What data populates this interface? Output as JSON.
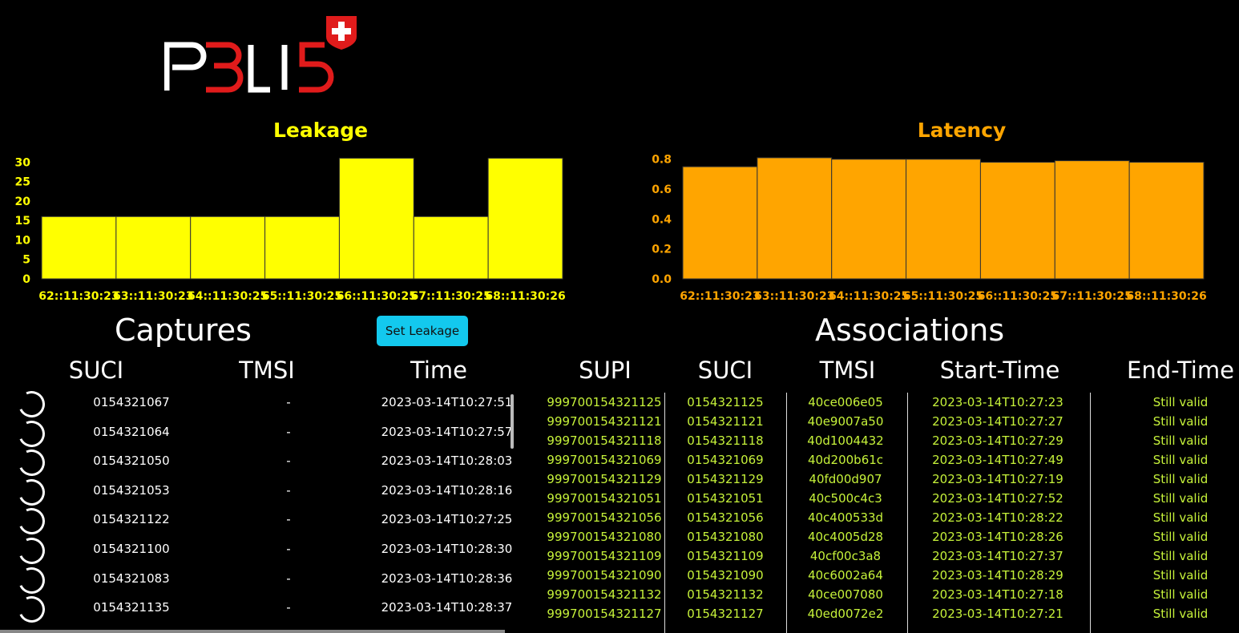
{
  "logo": {
    "text": "P3LI5",
    "flag": "swiss-flag"
  },
  "colors": {
    "leakage": "#ffff00",
    "latency": "#ffa500",
    "button": "#13c9ee",
    "assoc_text": "#c6f23a"
  },
  "chart_data": [
    {
      "type": "bar",
      "title": "Leakage",
      "categories": [
        "62::11:30:23",
        "63::11:30:23",
        "64::11:30:25",
        "65::11:30:25",
        "66::11:30:25",
        "67::11:30:25",
        "68::11:30:26"
      ],
      "values": [
        16,
        16,
        16,
        16,
        31,
        16,
        31
      ],
      "yticks": [
        0,
        5,
        10,
        15,
        20,
        25,
        30
      ],
      "ylim": [
        0,
        31.5
      ],
      "color": "#ffff00"
    },
    {
      "type": "bar",
      "title": "Latency",
      "categories": [
        "62::11:30:23",
        "63::11:30:23",
        "64::11:30:25",
        "65::11:30:25",
        "66::11:30:25",
        "67::11:30:25",
        "68::11:30:26"
      ],
      "values": [
        0.75,
        0.81,
        0.8,
        0.8,
        0.78,
        0.79,
        0.78
      ],
      "yticks": [
        "0.0",
        "0.2",
        "0.4",
        "0.6",
        "0.8"
      ],
      "ylim": [
        0,
        0.82
      ],
      "color": "#ffa500"
    }
  ],
  "captures": {
    "title": "Captures",
    "button_label": "Set Leakage",
    "headers": [
      "SUCI",
      "TMSI",
      "Time"
    ],
    "rows": [
      [
        "0154321067",
        "-",
        "2023-03-14T10:27:51"
      ],
      [
        "0154321064",
        "-",
        "2023-03-14T10:27:57"
      ],
      [
        "0154321050",
        "-",
        "2023-03-14T10:28:03"
      ],
      [
        "0154321053",
        "-",
        "2023-03-14T10:28:16"
      ],
      [
        "0154321122",
        "-",
        "2023-03-14T10:27:25"
      ],
      [
        "0154321100",
        "-",
        "2023-03-14T10:28:30"
      ],
      [
        "0154321083",
        "-",
        "2023-03-14T10:28:36"
      ],
      [
        "0154321135",
        "-",
        "2023-03-14T10:28:37"
      ]
    ]
  },
  "associations": {
    "title": "Associations",
    "headers": [
      "SUPI",
      "SUCI",
      "TMSI",
      "Start-Time",
      "End-Time"
    ],
    "rows": [
      [
        "999700154321125",
        "0154321125",
        "40ce006e05",
        "2023-03-14T10:27:23",
        "Still valid"
      ],
      [
        "999700154321121",
        "0154321121",
        "40e9007a50",
        "2023-03-14T10:27:27",
        "Still valid"
      ],
      [
        "999700154321118",
        "0154321118",
        "40d1004432",
        "2023-03-14T10:27:29",
        "Still valid"
      ],
      [
        "999700154321069",
        "0154321069",
        "40d200b61c",
        "2023-03-14T10:27:49",
        "Still valid"
      ],
      [
        "999700154321129",
        "0154321129",
        "40fd00d907",
        "2023-03-14T10:27:19",
        "Still valid"
      ],
      [
        "999700154321051",
        "0154321051",
        "40c500c4c3",
        "2023-03-14T10:27:52",
        "Still valid"
      ],
      [
        "999700154321056",
        "0154321056",
        "40c400533d",
        "2023-03-14T10:28:22",
        "Still valid"
      ],
      [
        "999700154321080",
        "0154321080",
        "40c4005d28",
        "2023-03-14T10:28:26",
        "Still valid"
      ],
      [
        "999700154321109",
        "0154321109",
        "40cf00c3a8",
        "2023-03-14T10:27:37",
        "Still valid"
      ],
      [
        "999700154321090",
        "0154321090",
        "40c6002a64",
        "2023-03-14T10:28:29",
        "Still valid"
      ],
      [
        "999700154321132",
        "0154321132",
        "40ce007080",
        "2023-03-14T10:27:18",
        "Still valid"
      ],
      [
        "999700154321127",
        "0154321127",
        "40ed0072e2",
        "2023-03-14T10:27:21",
        "Still valid"
      ]
    ]
  }
}
